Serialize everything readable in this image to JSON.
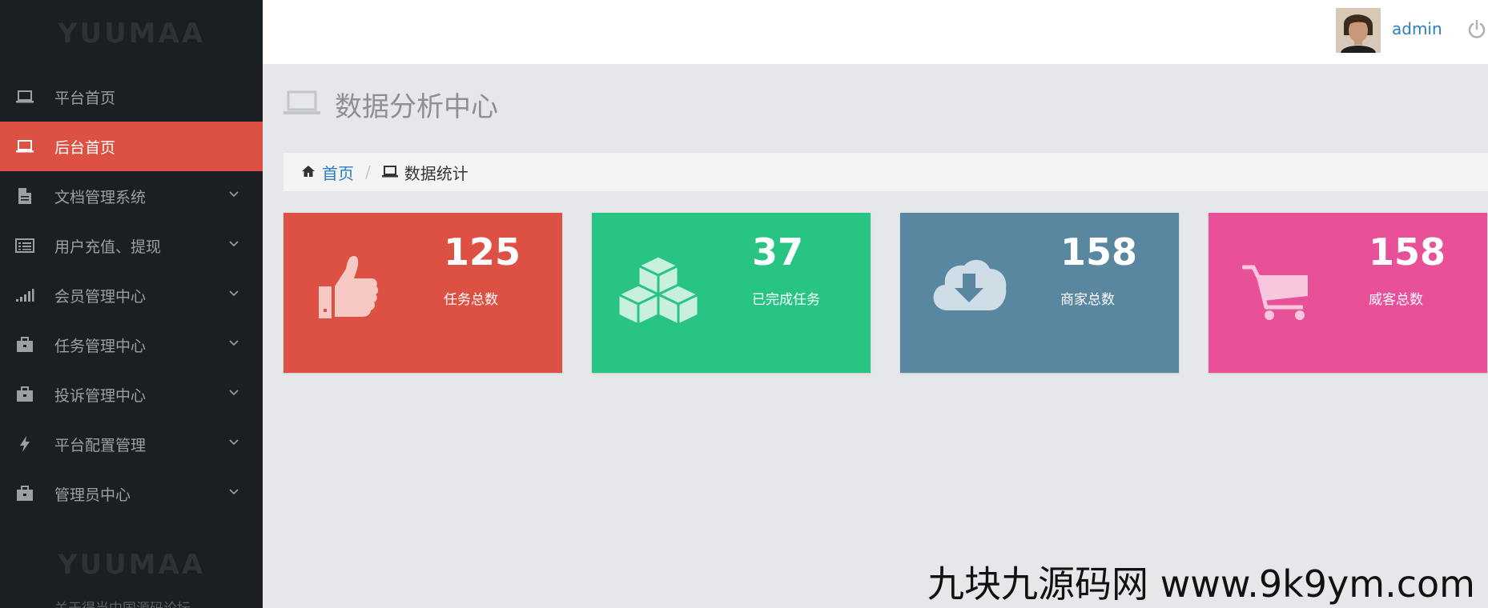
{
  "sidebar": {
    "logo": "YUUMAA",
    "items": [
      {
        "label": "平台首页",
        "icon": "laptop-icon"
      },
      {
        "label": "后台首页",
        "icon": "laptop-icon",
        "active": true
      },
      {
        "label": "文档管理系统",
        "icon": "file-icon"
      },
      {
        "label": "用户充值、提现",
        "icon": "list-icon"
      },
      {
        "label": "会员管理中心",
        "icon": "signal-icon"
      },
      {
        "label": "任务管理中心",
        "icon": "briefcase-icon"
      },
      {
        "label": "投诉管理中心",
        "icon": "briefcase-icon"
      },
      {
        "label": "平台配置管理",
        "icon": "bolt-icon"
      },
      {
        "label": "管理员中心",
        "icon": "briefcase-icon"
      }
    ],
    "footer_logo": "YUUMAA",
    "footer_text": "关于得当中国源码论坛"
  },
  "header": {
    "username": "admin"
  },
  "page": {
    "title": "数据分析中心"
  },
  "breadcrumb": {
    "home": "首页",
    "current": "数据统计"
  },
  "cards": [
    {
      "value": "125",
      "label": "任务总数",
      "color": "#dd5044",
      "icon": "thumbs-up-icon"
    },
    {
      "value": "37",
      "label": "已完成任务",
      "color": "#27c484",
      "icon": "cubes-icon"
    },
    {
      "value": "158",
      "label": "商家总数",
      "color": "#5987a0",
      "icon": "cloud-download-icon"
    },
    {
      "value": "158",
      "label": "威客总数",
      "color": "#e85197",
      "icon": "cart-icon"
    }
  ],
  "watermark": "九块九源码网 www.9k9ym.com"
}
